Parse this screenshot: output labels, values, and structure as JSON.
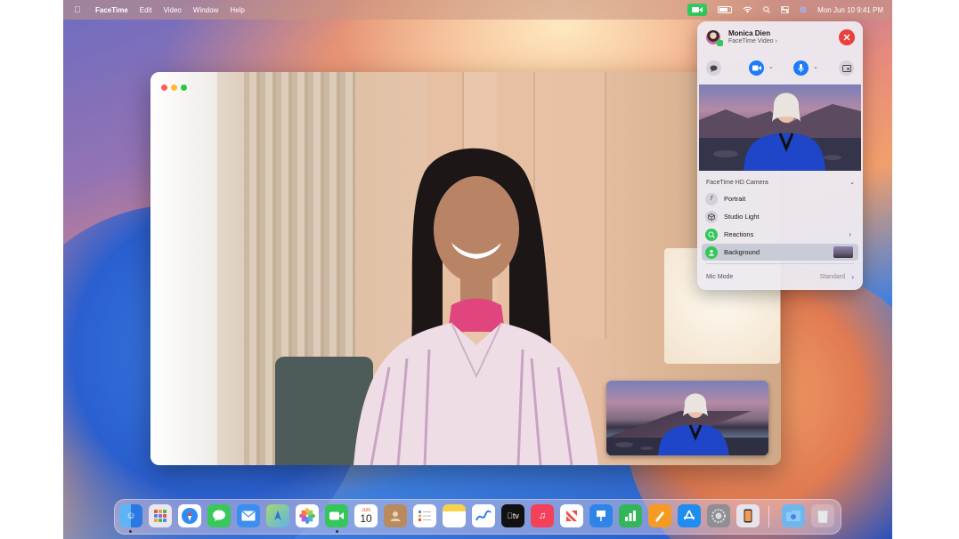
{
  "menubar": {
    "app_name": "FaceTime",
    "menus": [
      "Edit",
      "Video",
      "Window",
      "Help"
    ],
    "clock": "Mon Jun 10  9:41 PM"
  },
  "popover": {
    "contact_name": "Monica Dien",
    "call_type": "FaceTime Video",
    "call_type_chevron": "›",
    "camera_title": "FaceTime HD Camera",
    "options": [
      {
        "label": "Portrait",
        "icon": "f-icon"
      },
      {
        "label": "Studio Light",
        "icon": "cube-icon"
      },
      {
        "label": "Reactions",
        "icon": "reactions-icon"
      },
      {
        "label": "Background",
        "icon": "person-icon"
      }
    ],
    "mic_mode_label": "Mic Mode",
    "mic_mode_value": "Standard"
  },
  "dock": {
    "calendar_month": "JUN",
    "calendar_day": "10"
  },
  "colors": {
    "accent_blue": "#1f7af5",
    "status_green": "#34c759",
    "end_call_red": "#e8413b"
  }
}
